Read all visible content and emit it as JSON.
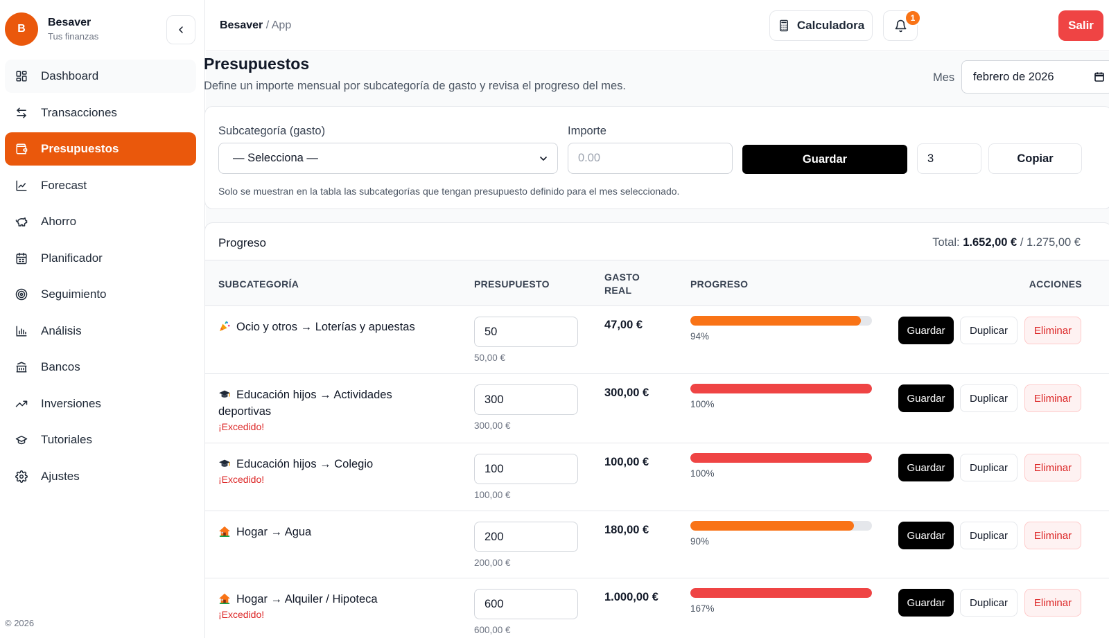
{
  "brand": {
    "initial": "B",
    "name": "Besaver",
    "subtitle": "Tus finanzas"
  },
  "sidebar": {
    "items": [
      {
        "label": "Dashboard",
        "icon": "dashboard-icon"
      },
      {
        "label": "Transacciones",
        "icon": "transfer-icon"
      },
      {
        "label": "Presupuestos",
        "icon": "wallet-icon",
        "active": true
      },
      {
        "label": "Forecast",
        "icon": "line-chart-icon"
      },
      {
        "label": "Ahorro",
        "icon": "piggy-bank-icon"
      },
      {
        "label": "Planificador",
        "icon": "calendar-icon"
      },
      {
        "label": "Seguimiento",
        "icon": "target-icon"
      },
      {
        "label": "Análisis",
        "icon": "bar-chart-icon"
      },
      {
        "label": "Bancos",
        "icon": "bank-icon"
      },
      {
        "label": "Inversiones",
        "icon": "trending-up-icon"
      },
      {
        "label": "Tutoriales",
        "icon": "graduation-cap-icon"
      },
      {
        "label": "Ajustes",
        "icon": "gear-icon"
      }
    ],
    "copyright": "© 2026"
  },
  "header": {
    "breadcrumb_root": "Besaver",
    "breadcrumb_sep": "/",
    "breadcrumb_current": "App",
    "calculator_label": "Calculadora",
    "notifications_count": "1",
    "logout_label": "Salir"
  },
  "page": {
    "title": "Presupuestos",
    "description": "Define un importe mensual por subcategoría de gasto y revisa el progreso del mes.",
    "month_label": "Mes",
    "month_value": "febrero de 2026"
  },
  "form": {
    "subcategory_label": "Subcategoría (gasto)",
    "subcategory_value": "— Selecciona —",
    "amount_label": "Importe",
    "amount_placeholder": "0.00",
    "save_label": "Guardar",
    "copy_count": "3",
    "copy_label": "Copiar",
    "hint": "Solo se muestran en la tabla las subcategorías que tengan presupuesto definido para el mes seleccionado."
  },
  "progress": {
    "title": "Progreso",
    "total_prefix": "Total:",
    "total_spent": "1.652,00 €",
    "total_sep": "/",
    "total_budget": "1.275,00 €",
    "columns": {
      "subcategory": "SUBCATEGORÍA",
      "budget": "PRESUPUESTO",
      "real_1": "GASTO",
      "real_2": "REAL",
      "progress": "PROGRESO",
      "actions": "ACCIONES"
    },
    "colors": {
      "warning": "#f97316",
      "exceeded": "#ef4444",
      "track": "#e5e7eb"
    },
    "rows": [
      {
        "icon": "party-popper-icon",
        "name": "Ocio y otros → Loterías y apuestas",
        "budget_input": "50",
        "budget_formatted": "50,00 €",
        "real": "47,00 €",
        "percent": 94,
        "percent_label": "94%",
        "status": "ok",
        "exceeded_label": ""
      },
      {
        "icon": "graduation-cap-icon",
        "name": "Educación hijos → Actividades deportivas",
        "budget_input": "300",
        "budget_formatted": "300,00 €",
        "real": "300,00 €",
        "percent": 100,
        "percent_label": "100%",
        "status": "exceeded",
        "exceeded_label": "¡Excedido!"
      },
      {
        "icon": "graduation-cap-icon",
        "name": "Educación hijos → Colegio",
        "budget_input": "100",
        "budget_formatted": "100,00 €",
        "real": "100,00 €",
        "percent": 100,
        "percent_label": "100%",
        "status": "exceeded",
        "exceeded_label": "¡Excedido!"
      },
      {
        "icon": "house-icon",
        "name": "Hogar → Agua",
        "budget_input": "200",
        "budget_formatted": "200,00 €",
        "real": "180,00 €",
        "percent": 90,
        "percent_label": "90%",
        "status": "ok",
        "exceeded_label": ""
      },
      {
        "icon": "house-icon",
        "name": "Hogar → Alquiler / Hipoteca",
        "budget_input": "600",
        "budget_formatted": "600,00 €",
        "real": "1.000,00 €",
        "percent": 167,
        "percent_label": "167%",
        "status": "exceeded",
        "exceeded_label": "¡Excedido!"
      }
    ],
    "row_actions": {
      "save": "Guardar",
      "duplicate": "Duplicar",
      "delete": "Eliminar"
    }
  }
}
